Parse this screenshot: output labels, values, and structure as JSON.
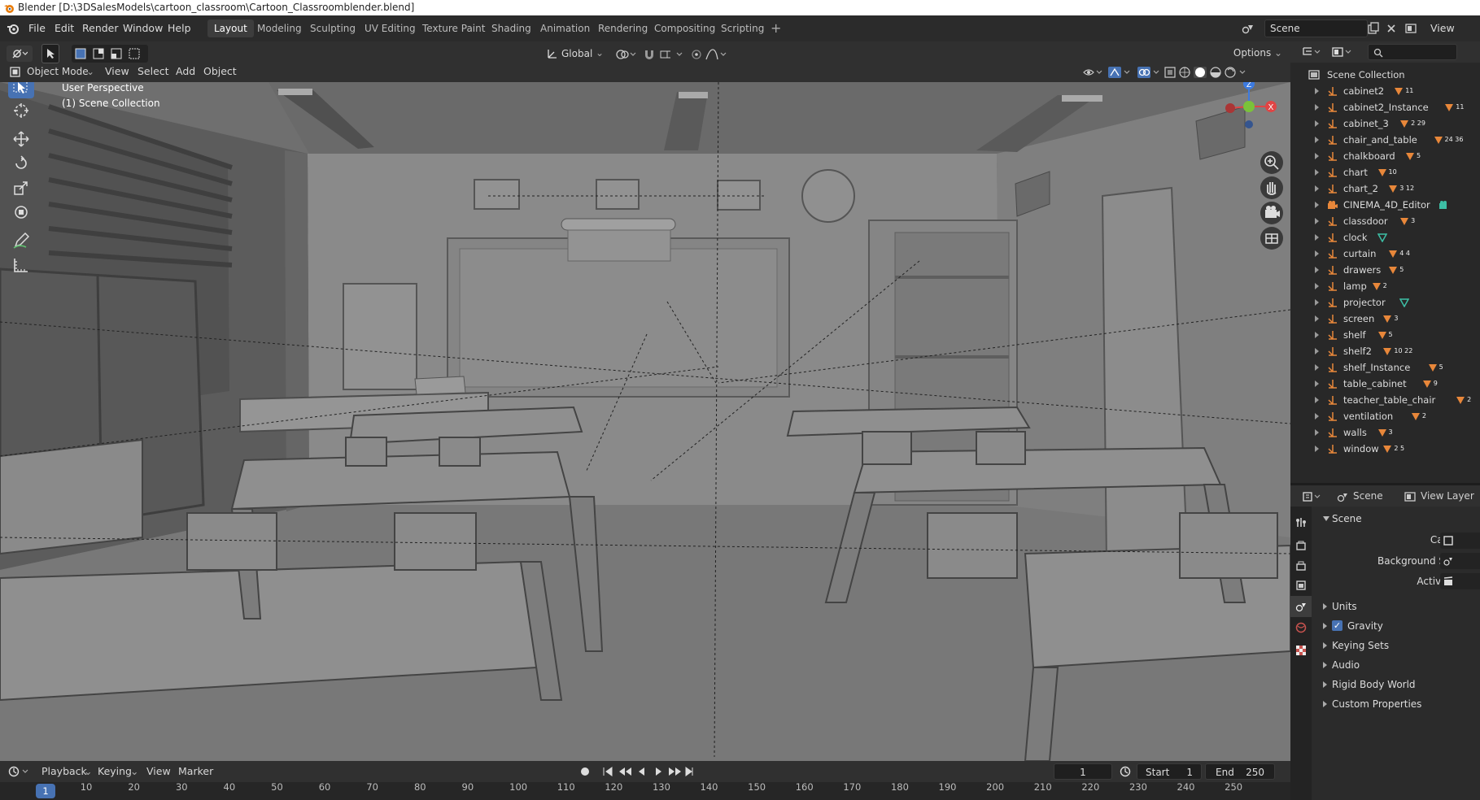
{
  "window": {
    "title": "Blender [D:\\3DSalesModels\\cartoon_classroom\\Cartoon_Classroomblender.blend]"
  },
  "menu": [
    "File",
    "Edit",
    "Render",
    "Window",
    "Help"
  ],
  "workspaces": [
    "Layout",
    "Modeling",
    "Sculpting",
    "UV Editing",
    "Texture Paint",
    "Shading",
    "Animation",
    "Rendering",
    "Compositing",
    "Scripting"
  ],
  "scene_field": "Scene",
  "view_layer_field": "View Layer",
  "viewport_header": {
    "mode": "Object Mode",
    "menus": [
      "View",
      "Select",
      "Add",
      "Object"
    ],
    "transform_orientation": "Global",
    "options_label": "Options"
  },
  "viewport": {
    "perspective": "User Perspective",
    "collection": "(1) Scene Collection",
    "axis_labels": [
      "Z",
      "X",
      "Y"
    ]
  },
  "outliner": {
    "root": "Scene Collection",
    "items": [
      {
        "name": "cabinet2",
        "badge": "11"
      },
      {
        "name": "cabinet2_Instance",
        "badge": "11"
      },
      {
        "name": "cabinet_3",
        "badge": "2 29"
      },
      {
        "name": "chair_and_table",
        "badge": "24 36"
      },
      {
        "name": "chalkboard",
        "badge": "5"
      },
      {
        "name": "chart",
        "badge": "10"
      },
      {
        "name": "chart_2",
        "badge": "3 12"
      },
      {
        "name": "CINEMA_4D_Editor",
        "badge": ""
      },
      {
        "name": "classdoor",
        "badge": "3"
      },
      {
        "name": "clock",
        "badge": ""
      },
      {
        "name": "curtain",
        "badge": "4 4"
      },
      {
        "name": "drawers",
        "badge": "5"
      },
      {
        "name": "lamp",
        "badge": "2"
      },
      {
        "name": "projector",
        "badge": ""
      },
      {
        "name": "screen",
        "badge": "3"
      },
      {
        "name": "shelf",
        "badge": "5"
      },
      {
        "name": "shelf2",
        "badge": "10 22"
      },
      {
        "name": "shelf_Instance",
        "badge": "5"
      },
      {
        "name": "table_cabinet",
        "badge": "9"
      },
      {
        "name": "teacher_table_chair",
        "badge": "2"
      },
      {
        "name": "ventilation",
        "badge": "2"
      },
      {
        "name": "walls",
        "badge": "3"
      },
      {
        "name": "window",
        "badge": "2 5"
      }
    ]
  },
  "properties": {
    "header_scene": "Scene",
    "header_view_layer": "View Layer",
    "panel_title": "Scene",
    "camera_label": "Camera",
    "background_scene_label": "Background Scene",
    "active_clip_label": "Active Clip",
    "sections": [
      "Units",
      "Gravity",
      "Keying Sets",
      "Audio",
      "Rigid Body World",
      "Custom Properties"
    ],
    "gravity_checked": true
  },
  "timeline": {
    "menus": [
      "Playback",
      "Keying",
      "View",
      "Marker"
    ],
    "current_frame": "1",
    "start_label": "Start",
    "start_value": "1",
    "end_label": "End",
    "end_value": "250",
    "ruler": [
      "1",
      "10",
      "20",
      "30",
      "40",
      "50",
      "60",
      "70",
      "80",
      "90",
      "100",
      "110",
      "120",
      "130",
      "140",
      "150",
      "160",
      "170",
      "180",
      "190",
      "200",
      "210",
      "220",
      "230",
      "240",
      "250"
    ]
  },
  "colors": {
    "accent": "#4772b3",
    "object_orange": "#e8873a",
    "mesh_teal": "#3dbfa6"
  }
}
